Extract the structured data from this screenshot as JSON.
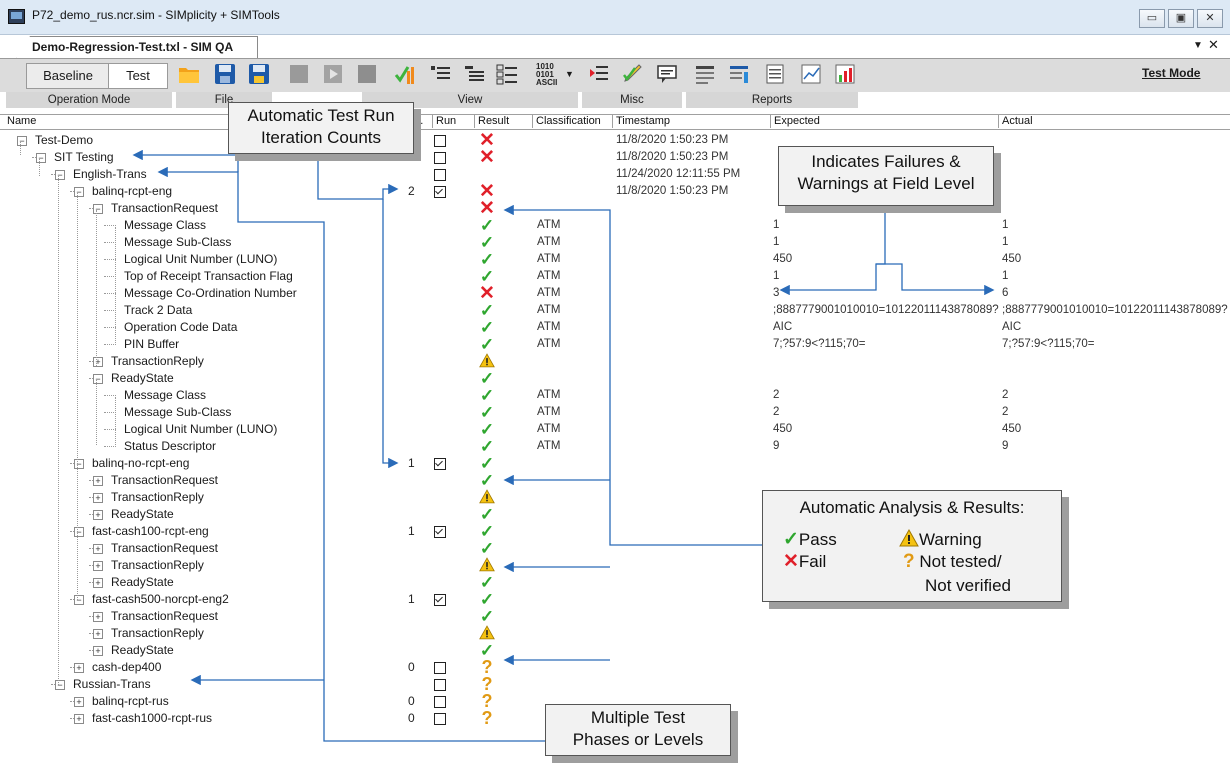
{
  "window": {
    "title": "P72_demo_rus.ncr.sim - SIMplicity + SIMTools"
  },
  "doc_tab": {
    "label": "Demo-Regression-Test.txl - SIM QA"
  },
  "window_buttons": {
    "minimize": "▭",
    "restore": "▣",
    "close": "✕"
  },
  "tab_controls": {
    "menu": "▼",
    "close": "✕"
  },
  "toolbar": {
    "baseline_label": "Baseline",
    "test_label": "Test",
    "test_mode_label": "Test Mode",
    "binary_icon_text": "1010\n0101\nASCII",
    "icons": [
      "folder-open-icon",
      "save-icon",
      "save-as-icon",
      "stop-gray-icon",
      "play-gray-icon",
      "stop-gray-icon",
      "check-chart-icon",
      "list-view-icon",
      "detail-view-icon",
      "checklist-view-icon",
      "binary-ascii-icon",
      "dropdown-arrow-icon",
      "test-list-icon",
      "edit-icon",
      "comment-icon",
      "report-icon",
      "summary-report-icon",
      "list-report-icon",
      "line-chart-icon",
      "bar-chart-icon"
    ],
    "groups": [
      "Operation Mode",
      "File",
      "View",
      "Misc",
      "Reports"
    ]
  },
  "columns": [
    "Name",
    "Iter.",
    "Run",
    "Result",
    "Classification",
    "Timestamp",
    "Expected",
    "Actual"
  ],
  "colors": {
    "pass": "#2fa62f",
    "fail": "#e0202a",
    "warning": "#f5c211",
    "untested": "#e19a14",
    "arrow": "#2a6bb8"
  },
  "rows": [
    {
      "name": "Test-Demo",
      "iter": "",
      "run": "off",
      "result": "fail",
      "classification": "",
      "timestamp": "11/8/2020 1:50:23 PM",
      "expected": "",
      "actual": ""
    },
    {
      "name": "SIT Testing",
      "iter": "",
      "run": "off",
      "result": "fail",
      "classification": "",
      "timestamp": "11/8/2020 1:50:23 PM",
      "expected": "",
      "actual": ""
    },
    {
      "name": "English-Trans",
      "iter": "",
      "run": "off",
      "result": "",
      "classification": "",
      "timestamp": "11/24/2020 12:11:55 PM",
      "expected": "",
      "actual": ""
    },
    {
      "name": "balinq-rcpt-eng",
      "iter": "2",
      "run": "on",
      "result": "fail",
      "classification": "",
      "timestamp": "11/8/2020 1:50:23 PM",
      "expected": "",
      "actual": ""
    },
    {
      "name": "TransactionRequest",
      "iter": "",
      "run": "",
      "result": "fail",
      "classification": "",
      "timestamp": "",
      "expected": "",
      "actual": ""
    },
    {
      "name": "Message Class",
      "iter": "",
      "run": "",
      "result": "pass",
      "classification": "ATM",
      "timestamp": "",
      "expected": "1",
      "actual": "1"
    },
    {
      "name": "Message Sub-Class",
      "iter": "",
      "run": "",
      "result": "pass",
      "classification": "ATM",
      "timestamp": "",
      "expected": "1",
      "actual": "1"
    },
    {
      "name": "Logical Unit Number (LUNO)",
      "iter": "",
      "run": "",
      "result": "pass",
      "classification": "ATM",
      "timestamp": "",
      "expected": "450",
      "actual": "450"
    },
    {
      "name": "Top of Receipt Transaction Flag",
      "iter": "",
      "run": "",
      "result": "pass",
      "classification": "ATM",
      "timestamp": "",
      "expected": "1",
      "actual": "1"
    },
    {
      "name": "Message Co-Ordination Number",
      "iter": "",
      "run": "",
      "result": "fail",
      "classification": "ATM",
      "timestamp": "",
      "expected": "3",
      "actual": "6"
    },
    {
      "name": "Track 2 Data",
      "iter": "",
      "run": "",
      "result": "pass",
      "classification": "ATM",
      "timestamp": "",
      "expected": ";8887779001010010=10122011143878089?",
      "actual": ";8887779001010010=10122011143878089?"
    },
    {
      "name": "Operation Code Data",
      "iter": "",
      "run": "",
      "result": "pass",
      "classification": "ATM",
      "timestamp": "",
      "expected": "AIC",
      "actual": "AIC"
    },
    {
      "name": "PIN Buffer",
      "iter": "",
      "run": "",
      "result": "pass",
      "classification": "ATM",
      "timestamp": "",
      "expected": "7;?57:9<?115;70=",
      "actual": "7;?57:9<?115;70="
    },
    {
      "name": "TransactionReply",
      "iter": "",
      "run": "",
      "result": "warn",
      "classification": "",
      "timestamp": "",
      "expected": "",
      "actual": ""
    },
    {
      "name": "ReadyState",
      "iter": "",
      "run": "",
      "result": "pass",
      "classification": "",
      "timestamp": "",
      "expected": "",
      "actual": ""
    },
    {
      "name": "Message Class",
      "iter": "",
      "run": "",
      "result": "pass",
      "classification": "ATM",
      "timestamp": "",
      "expected": "2",
      "actual": "2"
    },
    {
      "name": "Message Sub-Class",
      "iter": "",
      "run": "",
      "result": "pass",
      "classification": "ATM",
      "timestamp": "",
      "expected": "2",
      "actual": "2"
    },
    {
      "name": "Logical Unit Number (LUNO)",
      "iter": "",
      "run": "",
      "result": "pass",
      "classification": "ATM",
      "timestamp": "",
      "expected": "450",
      "actual": "450"
    },
    {
      "name": "Status Descriptor",
      "iter": "",
      "run": "",
      "result": "pass",
      "classification": "ATM",
      "timestamp": "",
      "expected": "9",
      "actual": "9"
    },
    {
      "name": "balinq-no-rcpt-eng",
      "iter": "1",
      "run": "on",
      "result": "pass",
      "classification": "",
      "timestamp": "",
      "expected": "",
      "actual": ""
    },
    {
      "name": "TransactionRequest",
      "iter": "",
      "run": "",
      "result": "pass",
      "classification": "",
      "timestamp": "",
      "expected": "",
      "actual": ""
    },
    {
      "name": "TransactionReply",
      "iter": "",
      "run": "",
      "result": "warn",
      "classification": "",
      "timestamp": "",
      "expected": "",
      "actual": ""
    },
    {
      "name": "ReadyState",
      "iter": "",
      "run": "",
      "result": "pass",
      "classification": "",
      "timestamp": "",
      "expected": "",
      "actual": ""
    },
    {
      "name": "fast-cash100-rcpt-eng",
      "iter": "1",
      "run": "on",
      "result": "pass",
      "classification": "",
      "timestamp": "",
      "expected": "",
      "actual": ""
    },
    {
      "name": "TransactionRequest",
      "iter": "",
      "run": "",
      "result": "pass",
      "classification": "",
      "timestamp": "",
      "expected": "",
      "actual": ""
    },
    {
      "name": "TransactionReply",
      "iter": "",
      "run": "",
      "result": "warn",
      "classification": "",
      "timestamp": "",
      "expected": "",
      "actual": ""
    },
    {
      "name": "ReadyState",
      "iter": "",
      "run": "",
      "result": "pass",
      "classification": "",
      "timestamp": "",
      "expected": "",
      "actual": ""
    },
    {
      "name": "fast-cash500-norcpt-eng2",
      "iter": "1",
      "run": "on",
      "result": "pass",
      "classification": "",
      "timestamp": "",
      "expected": "",
      "actual": ""
    },
    {
      "name": "TransactionRequest",
      "iter": "",
      "run": "",
      "result": "pass",
      "classification": "",
      "timestamp": "",
      "expected": "",
      "actual": ""
    },
    {
      "name": "TransactionReply",
      "iter": "",
      "run": "",
      "result": "warn",
      "classification": "",
      "timestamp": "",
      "expected": "",
      "actual": ""
    },
    {
      "name": "ReadyState",
      "iter": "",
      "run": "",
      "result": "pass",
      "classification": "",
      "timestamp": "",
      "expected": "",
      "actual": ""
    },
    {
      "name": "cash-dep400",
      "iter": "0",
      "run": "off",
      "result": "untested",
      "classification": "",
      "timestamp": "",
      "expected": "",
      "actual": ""
    },
    {
      "name": "Russian-Trans",
      "iter": "",
      "run": "off",
      "result": "untested",
      "classification": "",
      "timestamp": "",
      "expected": "",
      "actual": ""
    },
    {
      "name": "balinq-rcpt-rus",
      "iter": "0",
      "run": "off",
      "result": "untested",
      "classification": "",
      "timestamp": "",
      "expected": "",
      "actual": ""
    },
    {
      "name": "fast-cash1000-rcpt-rus",
      "iter": "0",
      "run": "off",
      "result": "untested",
      "classification": "",
      "timestamp": "",
      "expected": "",
      "actual": ""
    }
  ],
  "callouts": {
    "iteration": {
      "line1": "Automatic Test Run",
      "line2": "Iteration Counts"
    },
    "field_level": {
      "line1": "Indicates Failures &",
      "line2": "Warnings at Field Level"
    },
    "analysis": {
      "title": "Automatic Analysis & Results:",
      "pass": "Pass",
      "warning": "Warning",
      "fail": "Fail",
      "not_tested_1": "Not tested/",
      "not_tested_2": "Not verified"
    },
    "phases": {
      "line1": "Multiple Test",
      "line2": "Phases or Levels"
    }
  }
}
